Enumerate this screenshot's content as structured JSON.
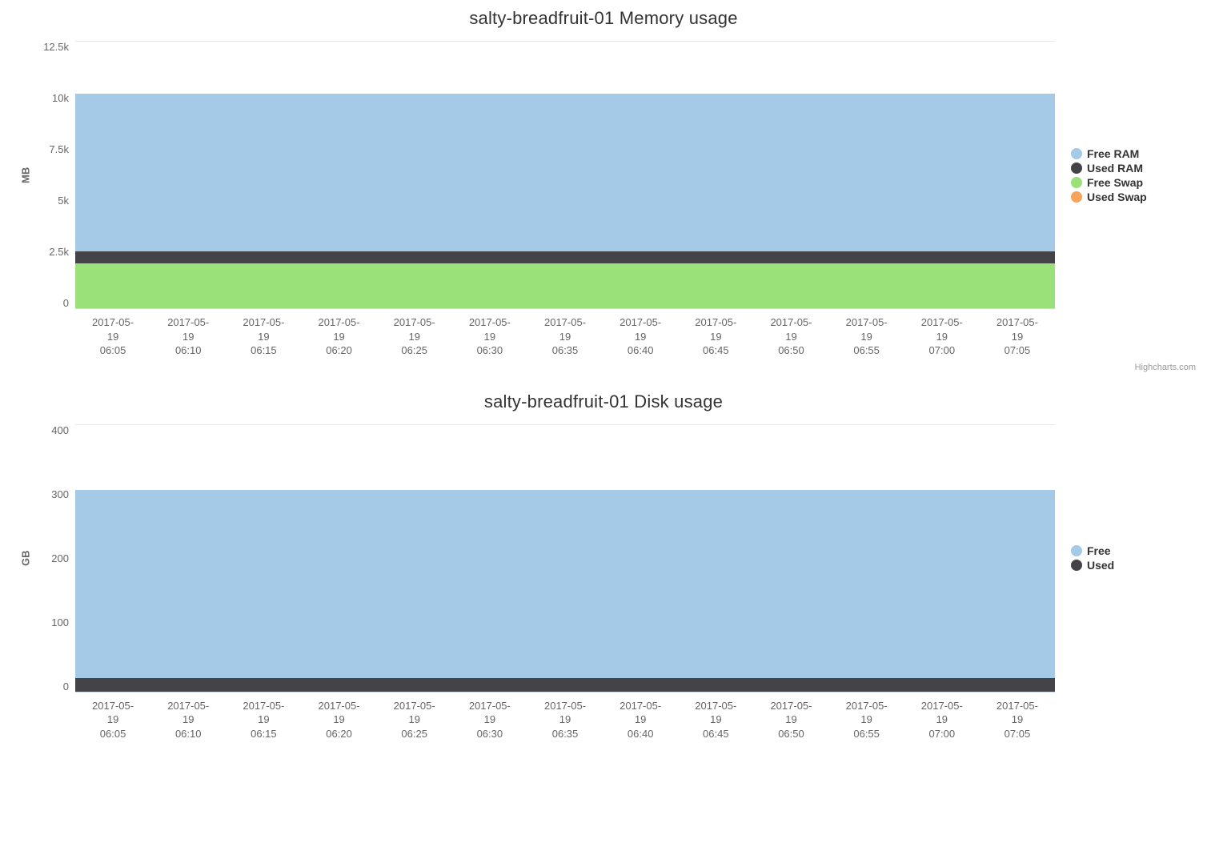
{
  "credits": "Highcharts.com",
  "x_categories": [
    "2017-05-\n19\n06:05",
    "2017-05-\n19\n06:10",
    "2017-05-\n19\n06:15",
    "2017-05-\n19\n06:20",
    "2017-05-\n19\n06:25",
    "2017-05-\n19\n06:30",
    "2017-05-\n19\n06:35",
    "2017-05-\n19\n06:40",
    "2017-05-\n19\n06:45",
    "2017-05-\n19\n06:50",
    "2017-05-\n19\n06:55",
    "2017-05-\n19\n07:00",
    "2017-05-\n19\n07:05"
  ],
  "memory": {
    "title": "salty-breadfruit-01 Memory usage",
    "ylabel": "MB",
    "yticks": [
      "12.5k",
      "10k",
      "7.5k",
      "5k",
      "2.5k",
      "0"
    ],
    "legend": [
      {
        "name": "Free RAM",
        "color": "#a4cae8"
      },
      {
        "name": "Used RAM",
        "color": "#434348"
      },
      {
        "name": "Free Swap",
        "color": "#9ae179"
      },
      {
        "name": "Used Swap",
        "color": "#f7a35c"
      }
    ]
  },
  "disk": {
    "title": "salty-breadfruit-01 Disk usage",
    "ylabel": "GB",
    "yticks": [
      "400",
      "300",
      "200",
      "100",
      "0"
    ],
    "legend": [
      {
        "name": "Free",
        "color": "#a4cae8"
      },
      {
        "name": "Used",
        "color": "#434348"
      }
    ]
  },
  "chart_data": [
    {
      "type": "area",
      "title": "salty-breadfruit-01 Memory usage",
      "xlabel": "",
      "ylabel": "MB",
      "ylim": [
        0,
        12500
      ],
      "stacked": true,
      "categories": [
        "2017-05-19 06:05",
        "2017-05-19 06:10",
        "2017-05-19 06:15",
        "2017-05-19 06:20",
        "2017-05-19 06:25",
        "2017-05-19 06:30",
        "2017-05-19 06:35",
        "2017-05-19 06:40",
        "2017-05-19 06:45",
        "2017-05-19 06:50",
        "2017-05-19 06:55",
        "2017-05-19 07:00",
        "2017-05-19 07:05"
      ],
      "series": [
        {
          "name": "Used Swap",
          "color": "#f7a35c",
          "values": [
            0,
            0,
            0,
            0,
            0,
            0,
            0,
            0,
            0,
            0,
            0,
            0,
            0
          ]
        },
        {
          "name": "Free Swap",
          "color": "#9ae179",
          "values": [
            2100,
            2100,
            2100,
            2100,
            2100,
            2100,
            2100,
            2100,
            2100,
            2100,
            2100,
            2100,
            2100
          ]
        },
        {
          "name": "Used RAM",
          "color": "#434348",
          "values": [
            550,
            550,
            550,
            550,
            550,
            550,
            550,
            550,
            550,
            550,
            550,
            550,
            550
          ]
        },
        {
          "name": "Free RAM",
          "color": "#a4cae8",
          "values": [
            7350,
            7350,
            7350,
            7350,
            7350,
            7350,
            7350,
            7350,
            7350,
            7350,
            7350,
            7350,
            7350
          ]
        }
      ]
    },
    {
      "type": "area",
      "title": "salty-breadfruit-01 Disk usage",
      "xlabel": "",
      "ylabel": "GB",
      "ylim": [
        0,
        400
      ],
      "stacked": true,
      "categories": [
        "2017-05-19 06:05",
        "2017-05-19 06:10",
        "2017-05-19 06:15",
        "2017-05-19 06:20",
        "2017-05-19 06:25",
        "2017-05-19 06:30",
        "2017-05-19 06:35",
        "2017-05-19 06:40",
        "2017-05-19 06:45",
        "2017-05-19 06:50",
        "2017-05-19 06:55",
        "2017-05-19 07:00",
        "2017-05-19 07:05"
      ],
      "series": [
        {
          "name": "Used",
          "color": "#434348",
          "values": [
            20,
            20,
            20,
            20,
            20,
            20,
            20,
            20,
            20,
            20,
            20,
            20,
            20
          ]
        },
        {
          "name": "Free",
          "color": "#a4cae8",
          "values": [
            280,
            280,
            280,
            280,
            280,
            280,
            280,
            280,
            280,
            280,
            280,
            280,
            280
          ]
        }
      ]
    }
  ]
}
